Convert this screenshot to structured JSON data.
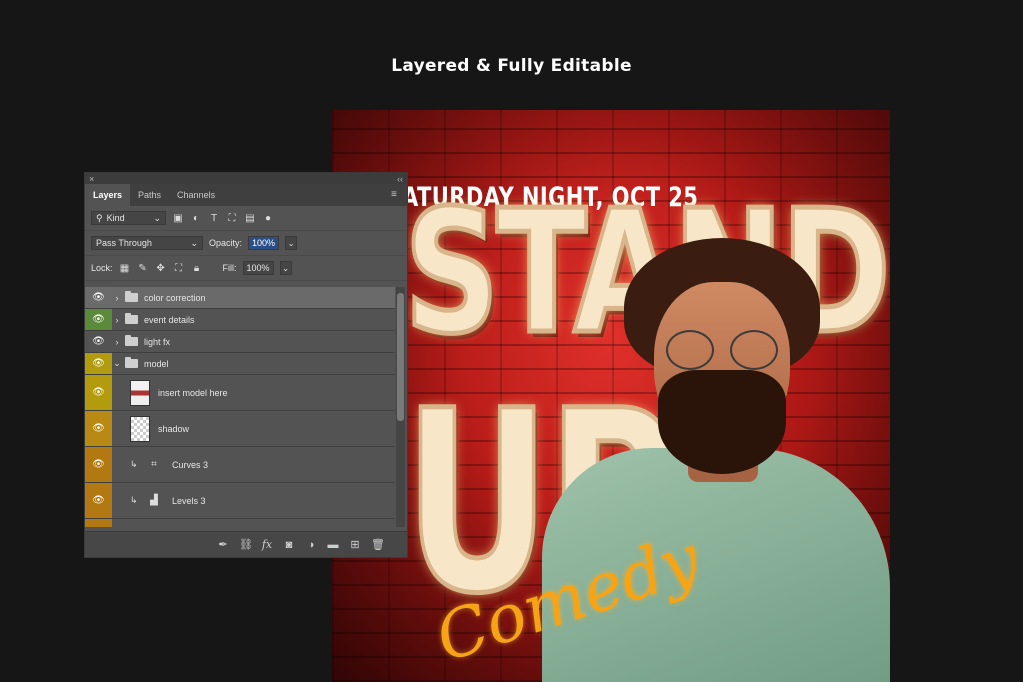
{
  "headline": "Layered & Fully Editable",
  "poster": {
    "tagline": "ATURDAY NIGHT, OCT 25",
    "title_line1": "STAND",
    "title_line2": "UP",
    "script": "Comedy",
    "colors": {
      "background": "#b41a17",
      "marquee": "#f7e6c8",
      "script": "#f6a316"
    }
  },
  "panel": {
    "close_glyph": "×",
    "collapse_glyph": "‹‹",
    "tabs": [
      "Layers",
      "Paths",
      "Channels"
    ],
    "active_tab": "Layers",
    "filter": {
      "label": "Kind",
      "icons": [
        "image-filter-icon",
        "adjustment-filter-icon",
        "type-filter-icon",
        "shape-filter-icon",
        "smart-object-filter-icon",
        "filter-toggle-icon"
      ]
    },
    "blend_mode": "Pass Through",
    "opacity_label": "Opacity:",
    "opacity_value": "100%",
    "lock_label": "Lock:",
    "fill_label": "Fill:",
    "fill_value": "100%",
    "layers": [
      {
        "name": "color correction",
        "type": "group",
        "expanded": false,
        "color": "#6b6b6b",
        "selected": true
      },
      {
        "name": "event details",
        "type": "group",
        "expanded": false,
        "color": "#5a8a3a",
        "selected": false
      },
      {
        "name": "light fx",
        "type": "group",
        "expanded": false,
        "color": "#535353",
        "selected": false
      },
      {
        "name": "model",
        "type": "group",
        "expanded": true,
        "color": "#b39b0e",
        "selected": false
      },
      {
        "name": "insert model here",
        "type": "smart",
        "color": "#b39b0e",
        "selected": false
      },
      {
        "name": "shadow",
        "type": "pixel",
        "color": "#b88a13",
        "selected": false
      },
      {
        "name": "Curves 3",
        "type": "curves",
        "color": "#b27812",
        "selected": false
      },
      {
        "name": "Levels 3",
        "type": "levels",
        "color": "#b27812",
        "selected": false
      }
    ],
    "footer_icons": [
      "link-layers-icon",
      "fx-icon",
      "mask-icon",
      "adjustment-layer-icon",
      "new-group-icon",
      "new-layer-icon",
      "trash-icon"
    ]
  }
}
